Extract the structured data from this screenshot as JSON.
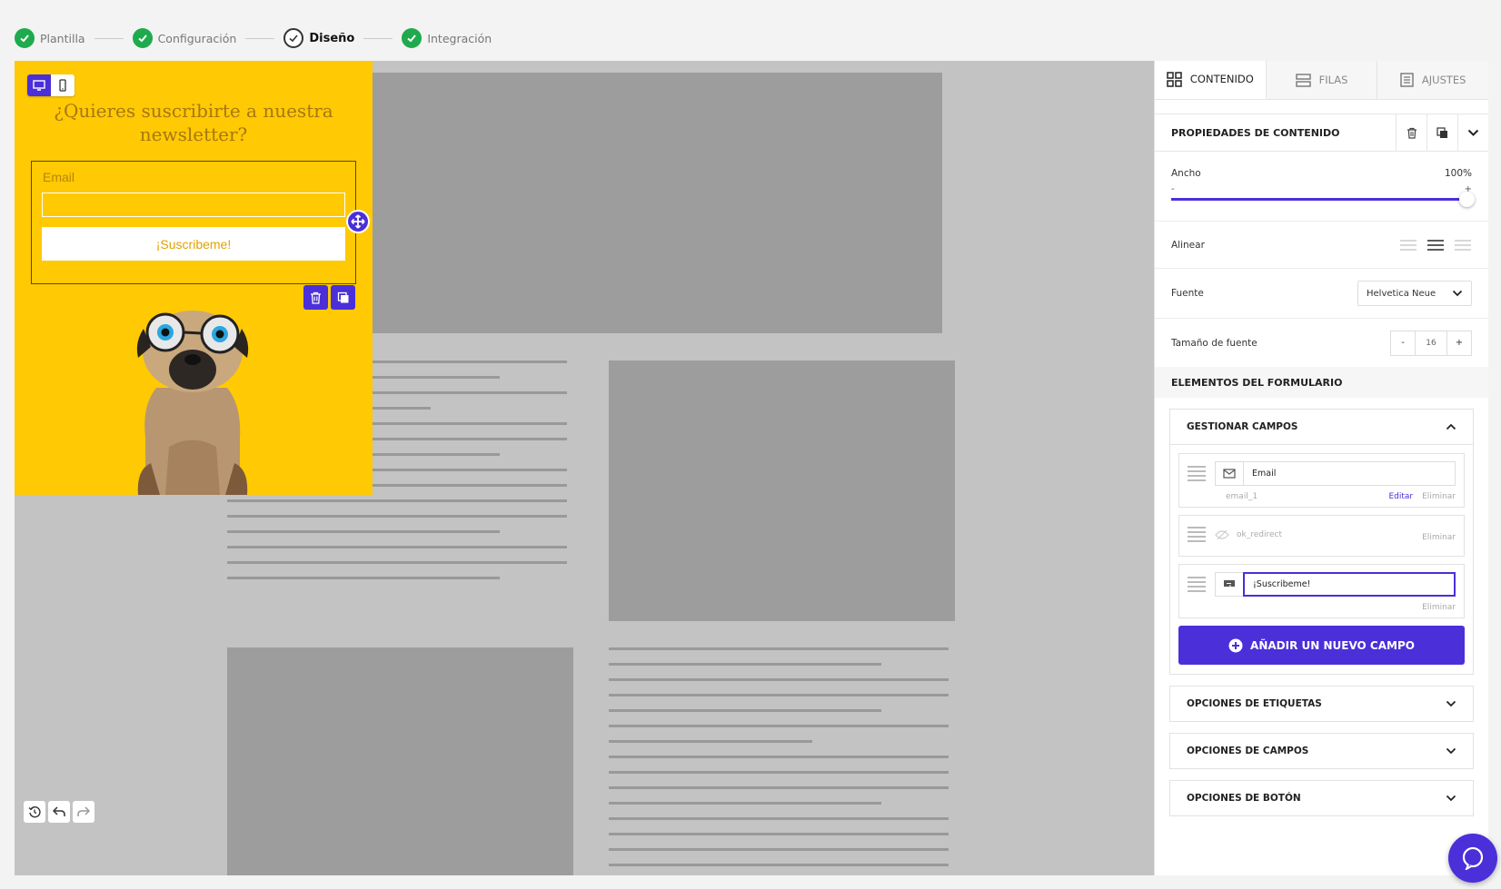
{
  "stepper": {
    "steps": [
      {
        "label": "Plantilla",
        "state": "done"
      },
      {
        "label": "Configuración",
        "state": "done"
      },
      {
        "label": "Diseño",
        "state": "current"
      },
      {
        "label": "Integración",
        "state": "done"
      }
    ]
  },
  "popup": {
    "title": "¿Quieres suscribirte a nuestra newsletter?",
    "email_label": "Email",
    "submit_label": "¡Suscribeme!",
    "background_color": "#ffc903",
    "image": "pug-with-googly-eye-glasses"
  },
  "panel": {
    "tabs": [
      {
        "label": "CONTENIDO",
        "icon": "grid-icon"
      },
      {
        "label": "FILAS",
        "icon": "rows-icon"
      },
      {
        "label": "AJUSTES",
        "icon": "settings-list-icon"
      }
    ],
    "properties_title": "PROPIEDADES DE CONTENIDO",
    "width_label": "Ancho",
    "width_value": "100%",
    "width_fraction": 1.0,
    "slider_minus": "-",
    "slider_plus": "+",
    "align_label": "Alinear",
    "font_label": "Fuente",
    "font_value": "Helvetica Neue",
    "font_size_label": "Tamaño de fuente",
    "font_size_minus": "-",
    "font_size_value": "16",
    "font_size_plus": "+",
    "form_elements_title": "ELEMENTOS DEL FORMULARIO",
    "manage_fields_title": "GESTIONAR CAMPOS",
    "fields": [
      {
        "icon": "envelope-icon",
        "value": "Email",
        "name": "email_1",
        "edit": "Editar",
        "delete": "Eliminar"
      },
      {
        "icon": "hidden-eye-icon",
        "value": "ok_redirect",
        "delete": "Eliminar"
      },
      {
        "icon": "button-icon",
        "value": "¡Suscribeme!",
        "delete": "Eliminar"
      }
    ],
    "add_field_label": "AÑADIR UN NUEVO CAMPO",
    "label_options": "OPCIONES DE ETIQUETAS",
    "field_options": "OPCIONES DE CAMPOS",
    "button_options": "OPCIONES DE BOTÓN"
  },
  "colors": {
    "accent": "#4b2fd8",
    "success": "#1faa4d",
    "popup_bg": "#ffc903"
  }
}
